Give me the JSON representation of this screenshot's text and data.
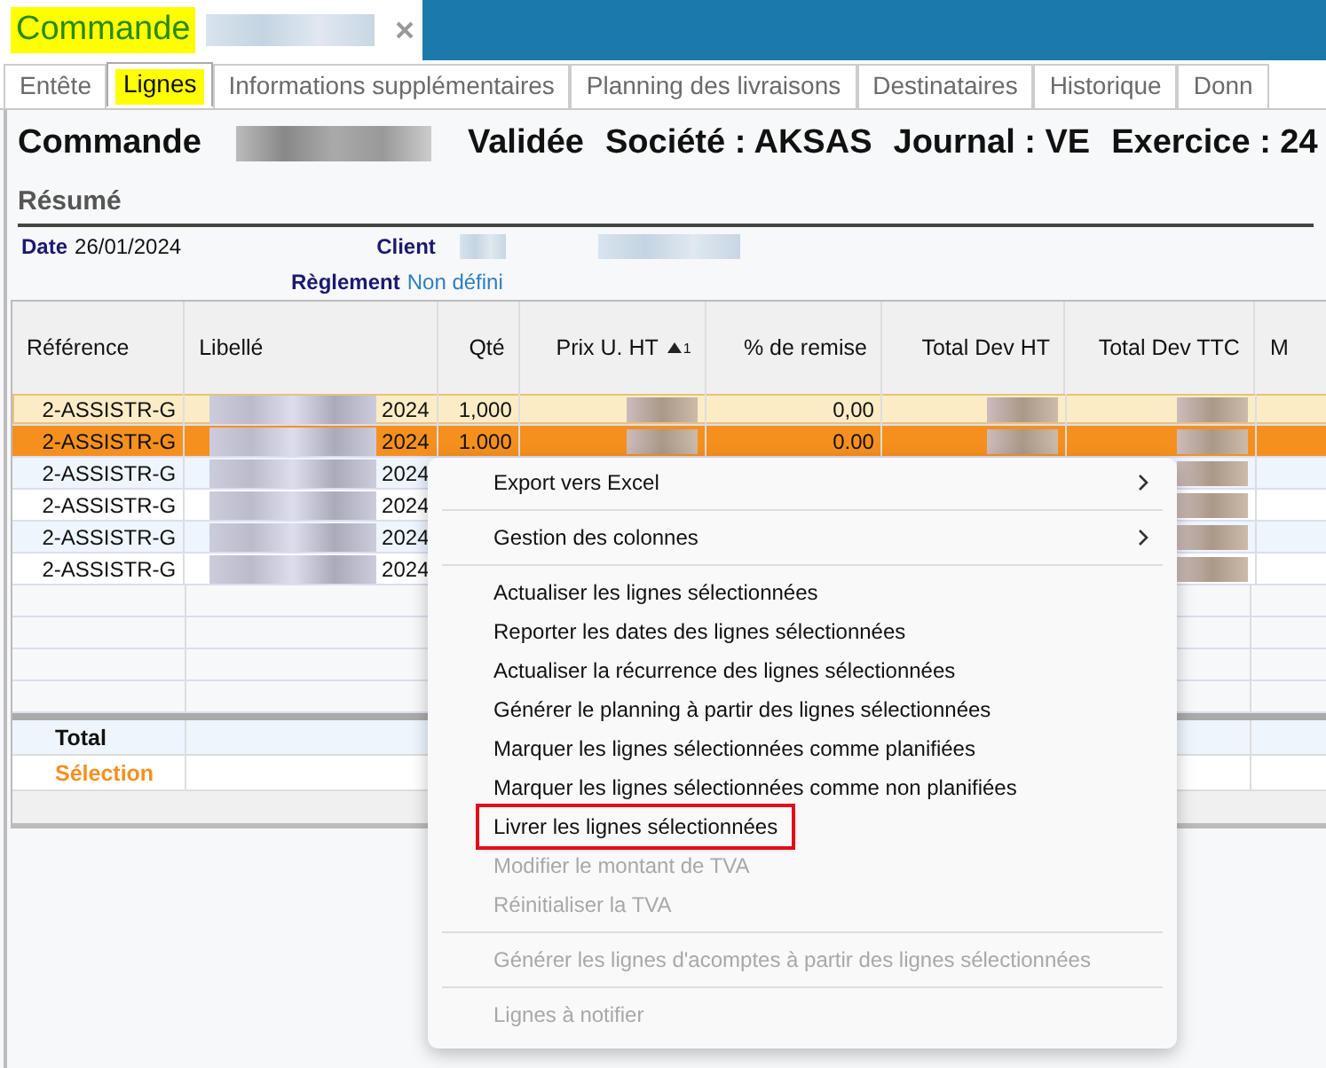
{
  "document_tab": {
    "title": "Commande"
  },
  "tabs": [
    {
      "label": "Entête",
      "selected": false
    },
    {
      "label": "Lignes",
      "selected": true
    },
    {
      "label": "Informations supplémentaires",
      "selected": false
    },
    {
      "label": "Planning des livraisons",
      "selected": false
    },
    {
      "label": "Destinataires",
      "selected": false
    },
    {
      "label": "Historique",
      "selected": false
    },
    {
      "label": "Donn",
      "selected": false
    }
  ],
  "heading": {
    "label": "Commande",
    "status": "Validée",
    "company": "Société : AKSAS",
    "journal": "Journal : VE",
    "fiscal_year": "Exercice : 24"
  },
  "summary": {
    "title": "Résumé",
    "date_label": "Date",
    "date": "26/01/2024",
    "client_label": "Client",
    "payment_label": "Règlement",
    "payment": "Non défini"
  },
  "table": {
    "columns": [
      {
        "label": "Référence"
      },
      {
        "label": "Libellé"
      },
      {
        "label": "Qté"
      },
      {
        "label": "Prix U. HT",
        "sort": "1"
      },
      {
        "label": "% de remise"
      },
      {
        "label": "Total Dev HT"
      },
      {
        "label": "Total Dev TTC"
      },
      {
        "label": "M"
      }
    ],
    "rows": [
      {
        "reference": "2-ASSISTR-G",
        "year": "2024",
        "quantity": "1,000",
        "discount": "0,00",
        "selected": false,
        "focused": true
      },
      {
        "reference": "2-ASSISTR-G",
        "year": "2024",
        "quantity": "1.000",
        "discount": "0.00",
        "selected": true,
        "focused": false
      },
      {
        "reference": "2-ASSISTR-G",
        "year": "2024",
        "selected": false,
        "focused": false
      },
      {
        "reference": "2-ASSISTR-G",
        "year": "2024",
        "selected": false,
        "focused": false
      },
      {
        "reference": "2-ASSISTR-G",
        "year": "2024",
        "selected": false,
        "focused": false
      },
      {
        "reference": "2-ASSISTR-G",
        "year": "2024",
        "selected": false,
        "focused": false
      }
    ],
    "total_label": "Total",
    "selection_label": "Sélection"
  },
  "context_menu": {
    "items": [
      {
        "kind": "item",
        "label": "Export vers Excel",
        "submenu": true,
        "disabled": false,
        "highlighted": false
      },
      {
        "kind": "separator"
      },
      {
        "kind": "item",
        "label": "Gestion des colonnes",
        "submenu": true,
        "disabled": false,
        "highlighted": false
      },
      {
        "kind": "separator"
      },
      {
        "kind": "item",
        "label": "Actualiser les lignes sélectionnées",
        "submenu": false,
        "disabled": false,
        "highlighted": false
      },
      {
        "kind": "item",
        "label": "Reporter les dates des lignes sélectionnées",
        "submenu": false,
        "disabled": false,
        "highlighted": false
      },
      {
        "kind": "item",
        "label": "Actualiser la récurrence des lignes sélectionnées",
        "submenu": false,
        "disabled": false,
        "highlighted": false
      },
      {
        "kind": "item",
        "label": "Générer le planning à partir des lignes sélectionnées",
        "submenu": false,
        "disabled": false,
        "highlighted": false
      },
      {
        "kind": "item",
        "label": "Marquer les lignes sélectionnées comme planifiées",
        "submenu": false,
        "disabled": false,
        "highlighted": false
      },
      {
        "kind": "item",
        "label": "Marquer les lignes sélectionnées comme non planifiées",
        "submenu": false,
        "disabled": false,
        "highlighted": false
      },
      {
        "kind": "item",
        "label": "Livrer les lignes sélectionnées",
        "submenu": false,
        "disabled": false,
        "highlighted": true
      },
      {
        "kind": "item",
        "label": "Modifier le montant de TVA",
        "submenu": false,
        "disabled": true,
        "highlighted": false
      },
      {
        "kind": "item",
        "label": "Réinitialiser la TVA",
        "submenu": false,
        "disabled": true,
        "highlighted": false
      },
      {
        "kind": "separator"
      },
      {
        "kind": "item",
        "label": "Générer les lignes d'acomptes à partir des lignes sélectionnées",
        "submenu": false,
        "disabled": true,
        "highlighted": false
      },
      {
        "kind": "separator"
      },
      {
        "kind": "item",
        "label": "Lignes à notifier",
        "submenu": false,
        "disabled": true,
        "highlighted": false
      }
    ]
  }
}
